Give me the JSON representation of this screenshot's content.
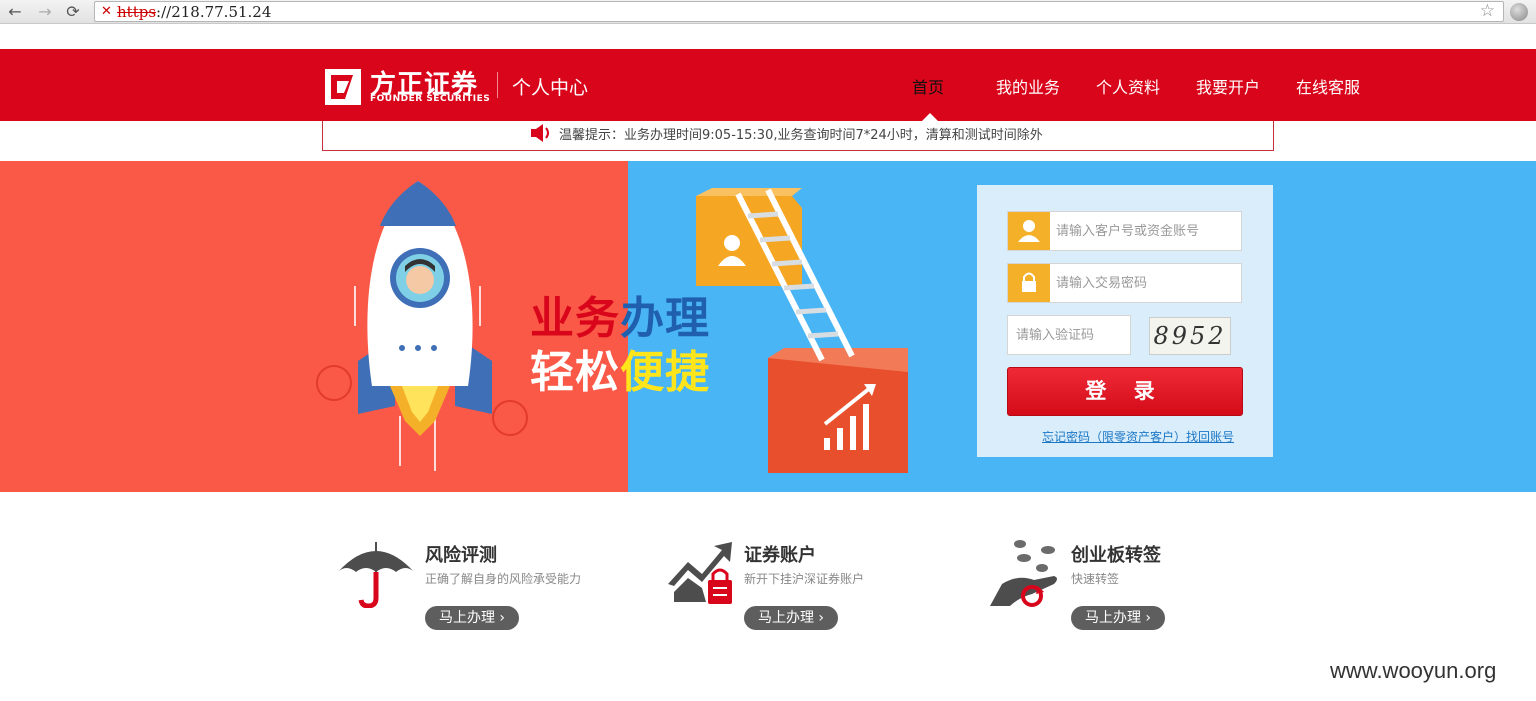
{
  "browser": {
    "url_scheme": "https",
    "url_rest": "://218.77.51.24"
  },
  "header": {
    "logo_cn": "方正证券",
    "logo_en": "FOUNDER SECURITIES",
    "subtitle": "个人中心",
    "nav": [
      "首页",
      "我的业务",
      "个人资料",
      "我要开户",
      "在线客服"
    ]
  },
  "notice": {
    "text": "温馨提示：业务办理时间9:05-15:30,业务查询时间7*24小时，清算和测试时间除外"
  },
  "banner": {
    "slogan_line1_a": "业务",
    "slogan_line1_b": "办理",
    "slogan_line2_a": "轻松",
    "slogan_line2_b": "便捷"
  },
  "login": {
    "account_placeholder": "请输入客户号或资金账号",
    "password_placeholder": "请输入交易密码",
    "captcha_placeholder": "请输入验证码",
    "captcha_value": "8952",
    "submit_label": "登 录",
    "forgot_link": "忘记密码（限零资产客户）",
    "recover_link": "找回账号"
  },
  "services": [
    {
      "title": "风险评测",
      "desc": "正确了解自身的风险承受能力",
      "button": "马上办理 ›"
    },
    {
      "title": "证券账户",
      "desc": "新开下挂沪深证券账户",
      "button": "马上办理 ›"
    },
    {
      "title": "创业板转签",
      "desc": "快速转签",
      "button": "马上办理 ›"
    }
  ],
  "watermark": "www.wooyun.org",
  "colors": {
    "brand_red": "#d9051b",
    "banner_left": "#fb5947",
    "banner_right": "#4ab5f5",
    "login_bg": "#d9edfb",
    "field_icon": "#f5b02a"
  }
}
